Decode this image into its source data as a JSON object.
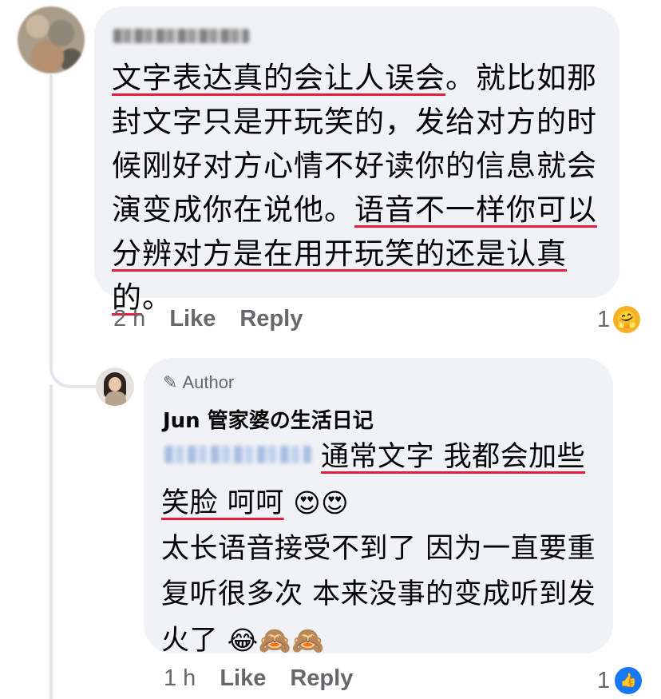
{
  "main_comment": {
    "text_part1": "文字表达真的会让人误会",
    "text_part2": "。就比如那封文字只是开玩笑的，发给对方的时候刚好对方心情不好读你的信息就会演变成你在说他。",
    "text_part3": "语音不一样你可以分辨对方是在用开玩笑的还是认真的",
    "text_part4": "。",
    "time": "2 h",
    "like_label": "Like",
    "reply_label": "Reply",
    "reaction_count": "1",
    "reaction_icon": "🤗"
  },
  "reply_comment": {
    "author_badge": "Author",
    "author_badge_icon": "✎",
    "name": "Jun 管家婆の生活日记",
    "text_underlined": "通常文字 我都会加些笑脸 呵呵",
    "text_emojis": "😍😍",
    "text_line2": "太长语音接受不到了 因为一直要重复听很多次 本来没事的变成听到发火了",
    "text_line2_emojis": "😂🙈🙈",
    "time": "1 h",
    "like_label": "Like",
    "reply_label": "Reply",
    "reaction_count": "1",
    "reaction_icon": "👍"
  }
}
